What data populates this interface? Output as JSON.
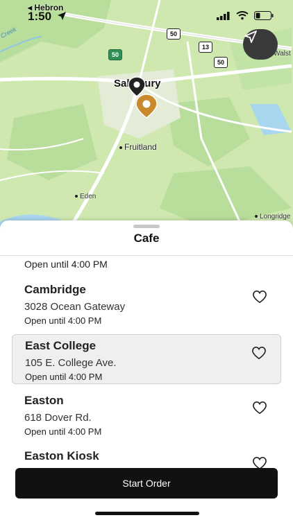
{
  "status_bar": {
    "back_app": "Hebron",
    "time": "1:50"
  },
  "map": {
    "labels": {
      "main_town": "Salisbury",
      "fruitland": "Fruitland",
      "eden": "Eden",
      "longridge": "Longridge",
      "walston": "Walst",
      "creek": "Creek"
    },
    "shields": {
      "route_50_a": "50",
      "route_50_b": "50",
      "route_50_c": "50",
      "route_13": "13"
    },
    "colors": {
      "land": "#cfe8b0",
      "forest": "#b7dc98",
      "road": "#ffffff",
      "pin_selected": "#c98a2e",
      "pin_other": "#222222"
    }
  },
  "sheet": {
    "title": "Cafe",
    "partial_item_hours": "Open until 4:00 PM",
    "items": [
      {
        "name": "Cambridge",
        "address": "3028 Ocean Gateway",
        "hours": "Open until 4:00 PM",
        "selected": false
      },
      {
        "name": "East College",
        "address": "105 E. College Ave.",
        "hours": "Open until 4:00 PM",
        "selected": true
      },
      {
        "name": "Easton",
        "address": "618 Dover Rd.",
        "hours": "Open until 4:00 PM",
        "selected": false
      },
      {
        "name": "Easton Kiosk",
        "address": "",
        "hours": "",
        "selected": false
      }
    ]
  },
  "actions": {
    "start_order": "Start Order"
  },
  "icons": {
    "locate": "navigation-arrow-icon",
    "favorite": "heart-icon"
  }
}
